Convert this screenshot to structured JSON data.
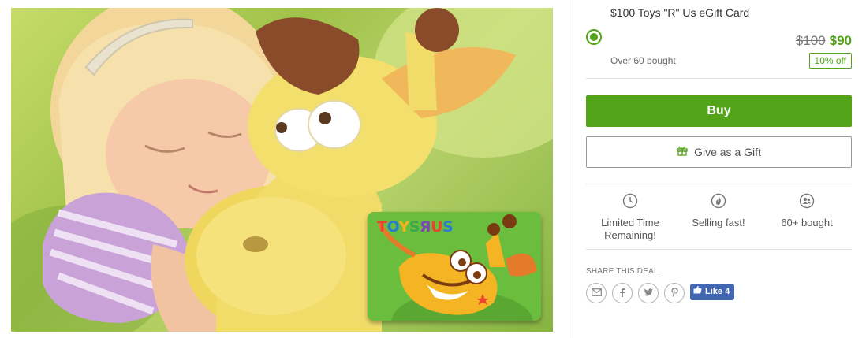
{
  "image": {
    "alt": "",
    "card_brand_letters": [
      "T",
      "o",
      "y",
      "s",
      "R",
      "u",
      "s"
    ]
  },
  "deal": {
    "title": "$100 Toys \"R\" Us eGift Card",
    "original_price": "$100",
    "sale_price": "$90",
    "bought_text": "Over 60 bought",
    "discount_badge": "10% off",
    "selected": true
  },
  "actions": {
    "buy_label": "Buy",
    "gift_label": "Give as a Gift"
  },
  "features": [
    {
      "icon": "clock-icon",
      "label": "Limited Time Remaining!"
    },
    {
      "icon": "flame-icon",
      "label": "Selling fast!"
    },
    {
      "icon": "people-icon",
      "label": "60+ bought"
    }
  ],
  "share": {
    "label": "SHARE THIS DEAL",
    "buttons": [
      "email-icon",
      "facebook-icon",
      "twitter-icon",
      "pinterest-icon"
    ],
    "like_label": "Like",
    "like_count": "4"
  },
  "colors": {
    "accent": "#53a318",
    "facebook": "#4267b2",
    "divider": "#e2e2e2"
  }
}
